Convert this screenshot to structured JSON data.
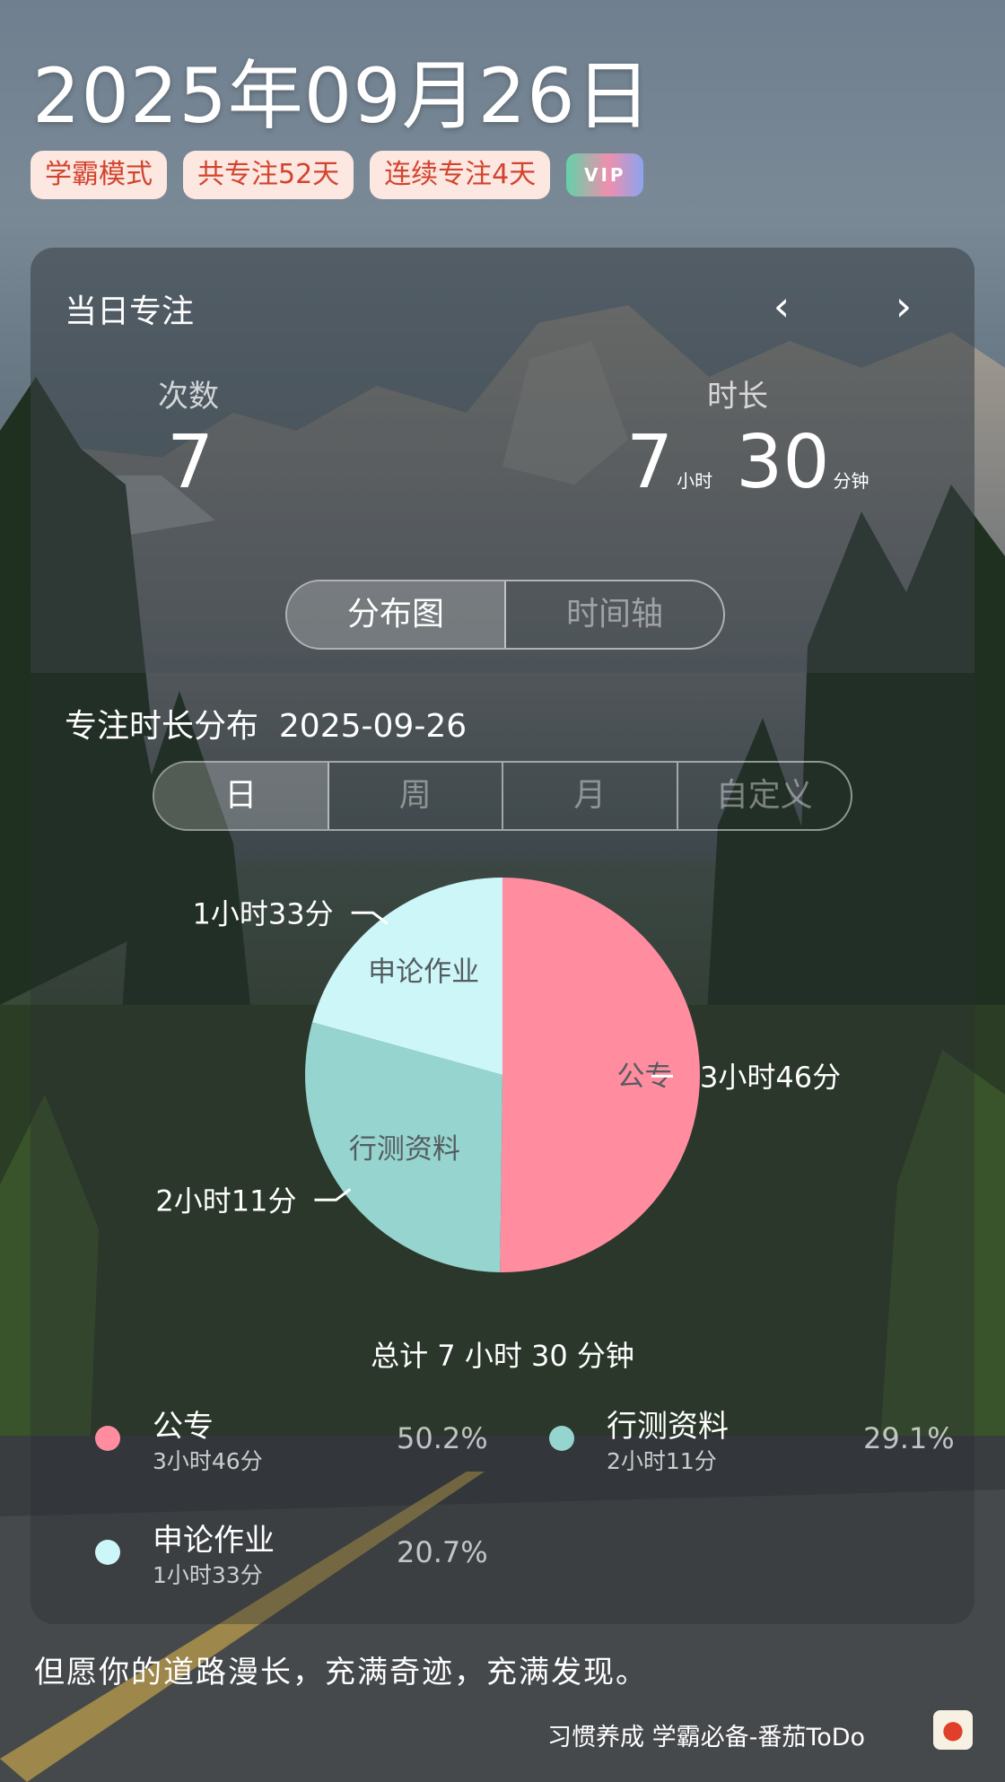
{
  "header": {
    "date": "2025年09月26日",
    "tags": [
      "学霸模式",
      "共专注52天",
      "连续专注4天"
    ],
    "vip_label": "VIP"
  },
  "daily": {
    "title": "当日专注",
    "count_label": "次数",
    "count_value": "7",
    "duration_label": "时长",
    "hours": "7",
    "hours_unit": "小时",
    "minutes": "30",
    "minutes_unit": "分钟"
  },
  "view_tabs": [
    "分布图",
    "时间轴"
  ],
  "distribution": {
    "title": "专注时长分布",
    "date": "2025-09-26",
    "periods": [
      "日",
      "周",
      "月",
      "自定义"
    ]
  },
  "chart_data": {
    "type": "pie",
    "slices": [
      {
        "name": "公专",
        "duration": "3小时46分",
        "percent": 50.2,
        "color": "#ff8c9f"
      },
      {
        "name": "行测资料",
        "duration": "2小时11分",
        "percent": 29.1,
        "color": "#96d4cf"
      },
      {
        "name": "申论作业",
        "duration": "1小时33分",
        "percent": 20.7,
        "color": "#ccf6f8"
      }
    ]
  },
  "total_text": "总计 7 小时 30 分钟",
  "legend": [
    {
      "name": "公专",
      "duration": "3小时46分",
      "percent": "50.2%"
    },
    {
      "name": "行测资料",
      "duration": "2小时11分",
      "percent": "29.1%"
    },
    {
      "name": "申论作业",
      "duration": "1小时33分",
      "percent": "20.7%"
    }
  ],
  "quote": "但愿你的道路漫长，充满奇迹，充满发现。",
  "footer": "习惯养成 学霸必备-番茄ToDo"
}
